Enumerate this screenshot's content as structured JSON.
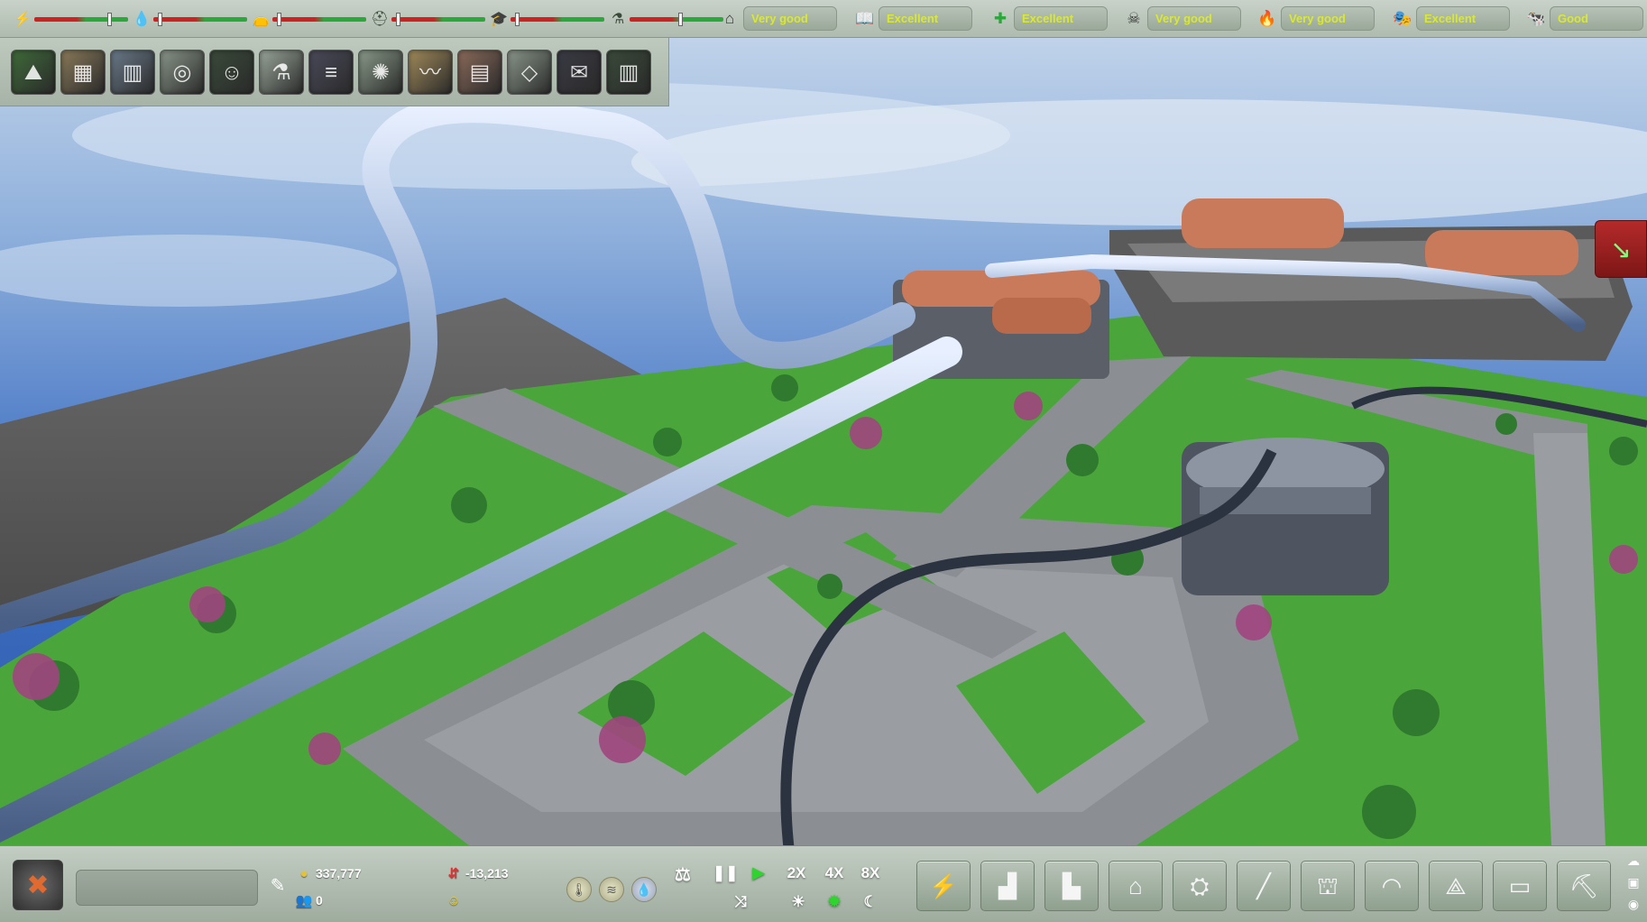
{
  "top_bar": {
    "sliders": [
      {
        "name": "power",
        "icon": "lightning-icon",
        "glyph": "⚡",
        "level": 0.82
      },
      {
        "name": "water",
        "icon": "water-drop-icon",
        "glyph": "💧",
        "level": 0.05
      },
      {
        "name": "waste",
        "icon": "garbage-bag-icon",
        "glyph": "👝",
        "level": 0.05
      },
      {
        "name": "workers",
        "icon": "worker-icon",
        "glyph": "⛑",
        "level": 0.05
      },
      {
        "name": "education",
        "icon": "student-icon",
        "glyph": "🎓",
        "level": 0.05
      },
      {
        "name": "research",
        "icon": "research-icon",
        "glyph": "⚗",
        "level": 0.55
      }
    ],
    "ratings": [
      {
        "name": "housing",
        "icon": "house-icon",
        "glyph": "⌂",
        "value": "Very good"
      },
      {
        "name": "knowledge",
        "icon": "book-icon",
        "glyph": "📖",
        "value": "Excellent"
      },
      {
        "name": "health",
        "icon": "cross-icon",
        "glyph": "✚",
        "value": "Excellent"
      },
      {
        "name": "crime",
        "icon": "skull-icon",
        "glyph": "☠",
        "value": "Very good"
      },
      {
        "name": "fire",
        "icon": "fire-icon",
        "glyph": "🔥",
        "value": "Very good"
      },
      {
        "name": "entertainment",
        "icon": "masks-icon",
        "glyph": "🎭",
        "value": "Excellent"
      },
      {
        "name": "environment",
        "icon": "cow-icon",
        "glyph": "🐄",
        "value": "Good"
      }
    ]
  },
  "toolbar": {
    "tools": [
      {
        "name": "terrain-tool",
        "glyph": "⛰",
        "bg": "#3f6a3a"
      },
      {
        "name": "resources-tool",
        "glyph": "▦",
        "bg": "#8a7a5a"
      },
      {
        "name": "statistics-tool",
        "glyph": "▥",
        "bg": "#6a7a8a"
      },
      {
        "name": "advisor-tool",
        "glyph": "◎",
        "bg": "#8a968a"
      },
      {
        "name": "population-tool",
        "glyph": "☺",
        "bg": "#3a4a3a"
      },
      {
        "name": "laboratory-tool",
        "glyph": "⚗",
        "bg": "#9aa69a"
      },
      {
        "name": "transport-tool",
        "glyph": "≡",
        "bg": "#4a4a5a"
      },
      {
        "name": "energy-tool",
        "glyph": "✺",
        "bg": "#8a9a8a"
      },
      {
        "name": "graph-tool",
        "glyph": "〰",
        "bg": "#a08a5a"
      },
      {
        "name": "documents-tool",
        "glyph": "▤",
        "bg": "#8a6a5a"
      },
      {
        "name": "map-tool",
        "glyph": "◇",
        "bg": "#8a968a"
      },
      {
        "name": "mail-tool",
        "glyph": "✉",
        "bg": "#3a3a44"
      },
      {
        "name": "library-tool",
        "glyph": "▥",
        "bg": "#3a4a3a"
      }
    ]
  },
  "bottom_bar": {
    "city_name": "",
    "money": "337,777",
    "population": "0",
    "income": "-13,213",
    "speeds": [
      "2X",
      "4X",
      "8X"
    ],
    "build_categories": [
      {
        "name": "build-energy-button",
        "glyph": "⚡"
      },
      {
        "name": "build-residential-button",
        "glyph": "▟"
      },
      {
        "name": "build-industry-button",
        "glyph": "▙"
      },
      {
        "name": "build-services-button",
        "glyph": "⌂"
      },
      {
        "name": "build-factory-button",
        "glyph": "⛭"
      },
      {
        "name": "build-roads-button",
        "glyph": "╱"
      },
      {
        "name": "build-government-button",
        "glyph": "⛫"
      },
      {
        "name": "build-dome-button",
        "glyph": "◠"
      },
      {
        "name": "build-tower-button",
        "glyph": "⟁"
      },
      {
        "name": "build-storage-button",
        "glyph": "▭"
      },
      {
        "name": "build-demolish-button",
        "glyph": "⛏"
      }
    ]
  },
  "colors": {
    "good_rating": "#d9e833",
    "alert": "#b52a2a"
  }
}
